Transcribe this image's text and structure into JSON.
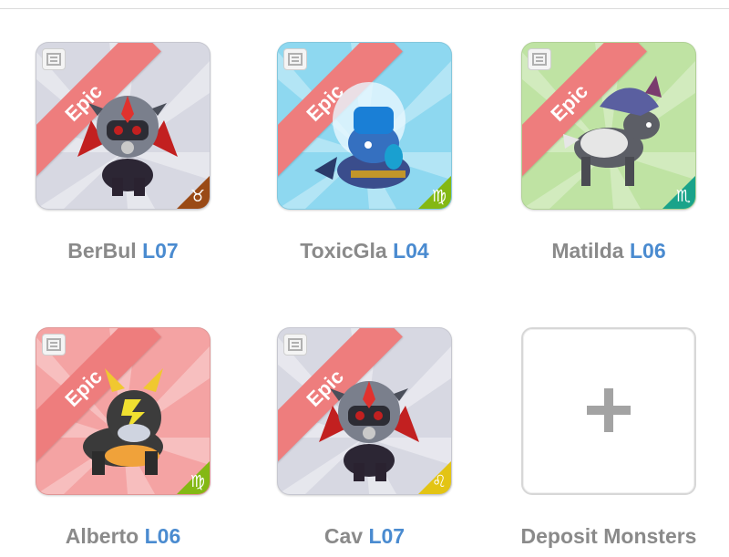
{
  "monsters": [
    {
      "name": "BerBul",
      "level": "L07",
      "rarity": "Epic",
      "zodiac_symbol": "♉",
      "zodiac_color": "#9a4a16",
      "bg": "#d7d8e2",
      "creature": "helmet-knight-icon"
    },
    {
      "name": "ToxicGla",
      "level": "L04",
      "rarity": "Epic",
      "zodiac_symbol": "♍",
      "zodiac_color": "#84b814",
      "bg": "#8ed8f0",
      "creature": "sea-monster-icon"
    },
    {
      "name": "Matilda",
      "level": "L06",
      "rarity": "Epic",
      "zodiac_symbol": "♏",
      "zodiac_color": "#1aa38a",
      "bg": "#bfe3a3",
      "creature": "wolf-icon"
    },
    {
      "name": "Alberto",
      "level": "L06",
      "rarity": "Epic",
      "zodiac_symbol": "♍",
      "zodiac_color": "#84b814",
      "bg": "#f4a3a3",
      "creature": "bulldog-icon"
    },
    {
      "name": "Cav",
      "level": "L07",
      "rarity": "Epic",
      "zodiac_symbol": "♌",
      "zodiac_color": "#e3c414",
      "bg": "#d7d8e2",
      "creature": "helmet-knight-icon"
    }
  ],
  "deposit": {
    "label": "Deposit Monsters"
  },
  "colors": {
    "label_gray": "#8a8a8a",
    "level_blue": "#4a8bd0",
    "ribbon": "#ee7d7d"
  }
}
